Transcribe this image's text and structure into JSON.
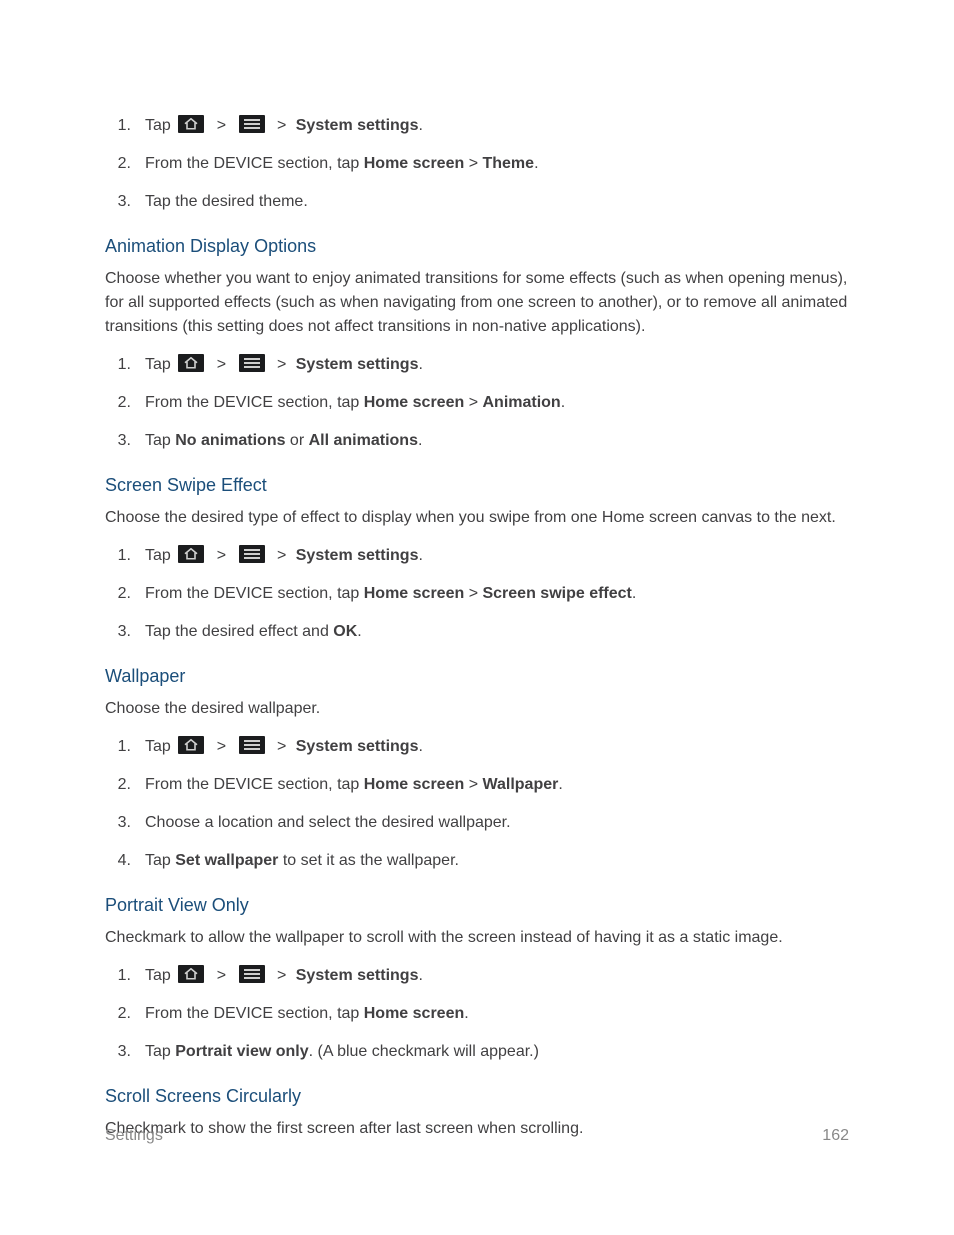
{
  "ui": {
    "system_settings": "System settings",
    "chevron": ">",
    "period": "."
  },
  "theme_section": {
    "steps": [
      {
        "n": "1.",
        "prefix": "Tap ",
        "nav_prefix": "",
        "nav_target": "System settings",
        "suffix": "."
      },
      {
        "n": "2.",
        "text_a": "From the DEVICE section, tap ",
        "b1": "Home screen",
        "mid": " > ",
        "b2": "Theme",
        "suffix": "."
      },
      {
        "n": "3.",
        "text": "Tap the desired theme."
      }
    ]
  },
  "animation": {
    "heading": "Animation Display Options",
    "intro": "Choose whether you want to enjoy animated transitions for some effects (such as when opening menus), for all supported effects (such as when navigating from one screen to another), or to remove all animated transitions (this setting does not affect transitions in non-native applications).",
    "steps": [
      {
        "n": "1.",
        "prefix": "Tap ",
        "nav_target": "System settings",
        "suffix": "."
      },
      {
        "n": "2.",
        "text_a": "From the DEVICE section, tap ",
        "b1": "Home screen",
        "mid": " > ",
        "b2": "Animation",
        "suffix": "."
      },
      {
        "n": "3.",
        "text_a": "Tap ",
        "b1": "No animations",
        "mid": " or ",
        "b2": "All animations",
        "suffix": "."
      }
    ]
  },
  "swipe": {
    "heading": "Screen Swipe Effect",
    "intro": "Choose the desired type of effect to display when you swipe from one Home screen canvas to the next.",
    "steps": [
      {
        "n": "1.",
        "prefix": "Tap ",
        "nav_target": "System settings",
        "suffix": "."
      },
      {
        "n": "2.",
        "text_a": "From the DEVICE section, tap ",
        "b1": "Home screen",
        "mid": " > ",
        "b2": "Screen swipe effect",
        "suffix": "."
      },
      {
        "n": "3.",
        "text_a": "Tap the desired effect and ",
        "b1": "OK",
        "suffix": "."
      }
    ]
  },
  "wallpaper": {
    "heading": "Wallpaper",
    "intro": "Choose the desired wallpaper.",
    "steps": [
      {
        "n": "1.",
        "prefix": "Tap ",
        "nav_target": "System settings",
        "suffix": "."
      },
      {
        "n": "2.",
        "text_a": "From the DEVICE section, tap ",
        "b1": "Home screen",
        "mid": " > ",
        "b2": "Wallpaper",
        "suffix": "."
      },
      {
        "n": "3.",
        "text": "Choose a location and select the desired wallpaper."
      },
      {
        "n": "4.",
        "text_a": "Tap ",
        "b1": "Set wallpaper",
        "suffix": " to set it as the wallpaper."
      }
    ]
  },
  "portrait": {
    "heading": "Portrait View Only",
    "intro": "Checkmark to allow the wallpaper to scroll with the screen instead of having it as a static image.",
    "steps": [
      {
        "n": "1.",
        "prefix": "Tap ",
        "nav_target": "System settings",
        "suffix": "."
      },
      {
        "n": "2.",
        "text_a": "From the DEVICE section, tap ",
        "b1": "Home screen",
        "suffix": "."
      },
      {
        "n": "3.",
        "text_a": "Tap ",
        "b1": "Portrait view only",
        "suffix": ". (A blue checkmark will appear.)"
      }
    ]
  },
  "scroll": {
    "heading": "Scroll Screens Circularly",
    "intro": "Checkmark to show the first screen after last screen when scrolling."
  },
  "footer": {
    "section": "Settings",
    "page": "162"
  }
}
